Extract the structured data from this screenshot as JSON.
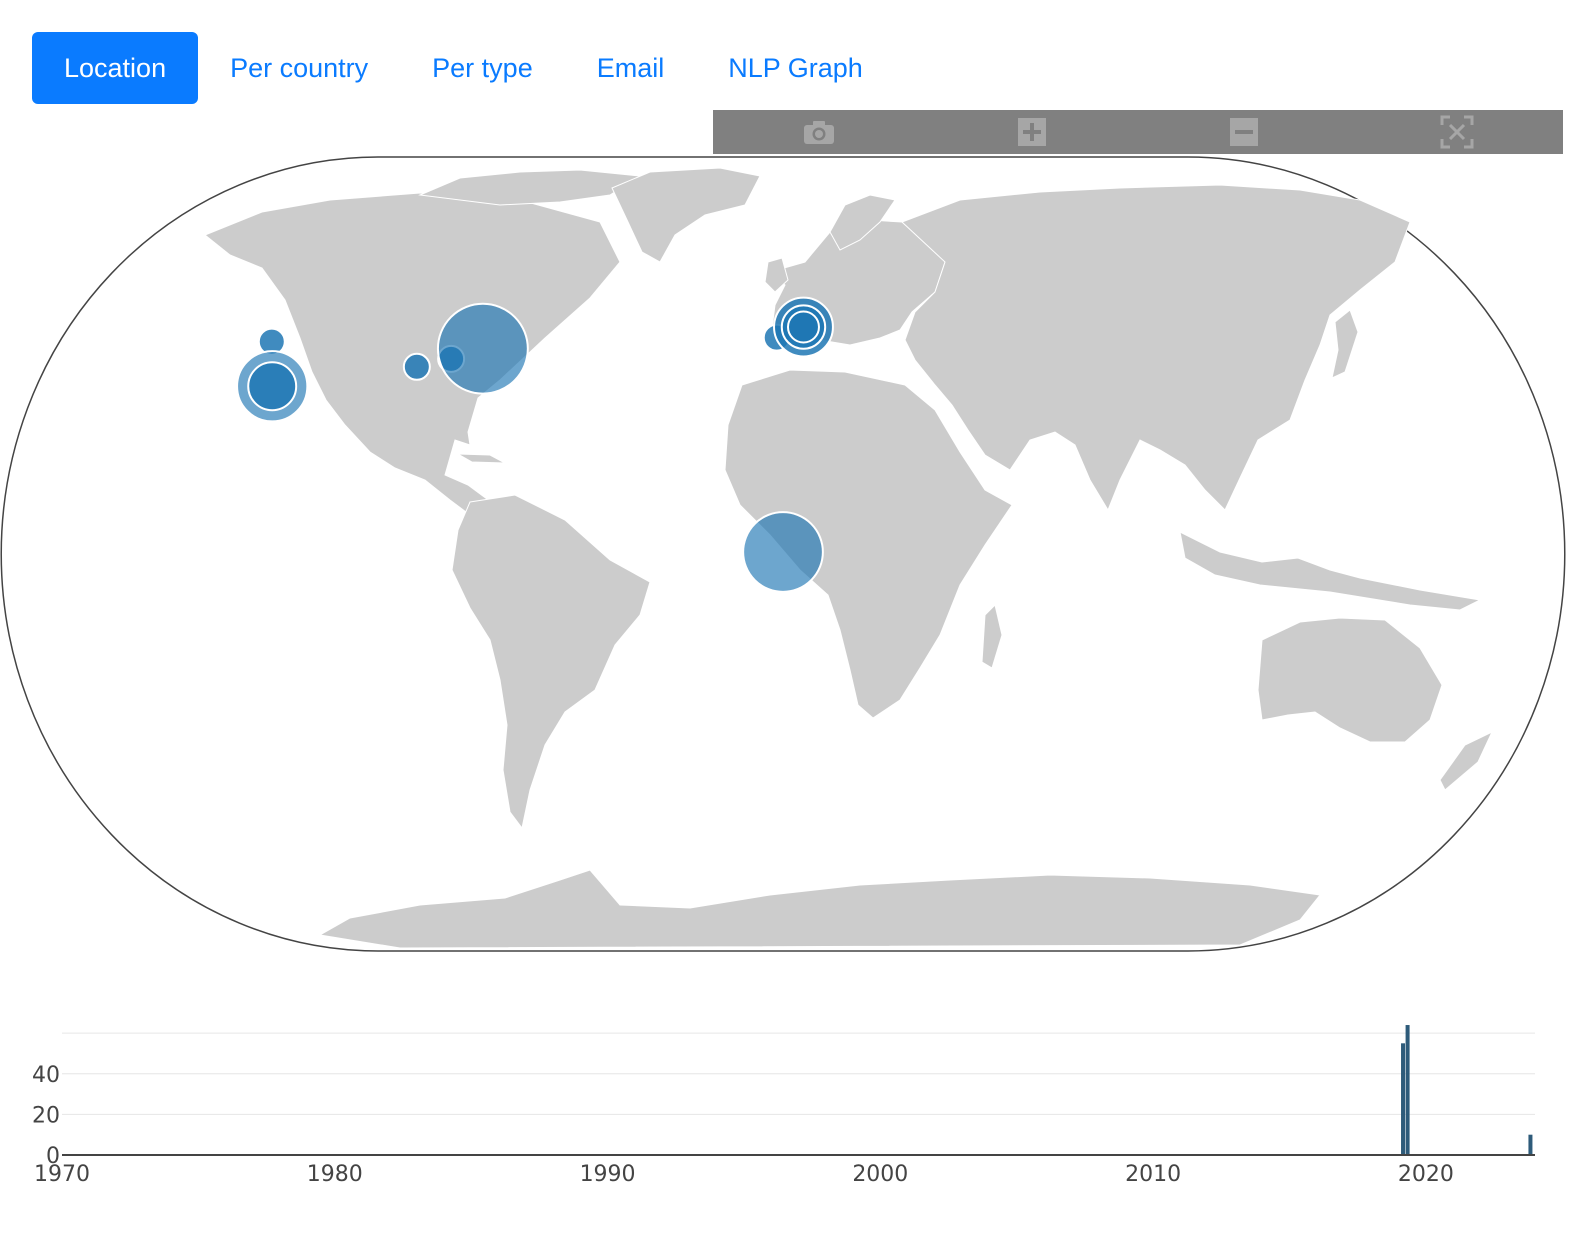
{
  "tabs": [
    {
      "label": "Location",
      "active": true
    },
    {
      "label": "Per country",
      "active": false
    },
    {
      "label": "Per type",
      "active": false
    },
    {
      "label": "Email",
      "active": false
    },
    {
      "label": "NLP Graph",
      "active": false
    }
  ],
  "modebar": {
    "buttons": [
      "camera-icon",
      "zoom-in-icon",
      "zoom-out-icon",
      "reset-view-icon"
    ],
    "background": "#808080"
  },
  "map": {
    "projection": "natural-earth",
    "land_color": "#cccccc",
    "marker_color": "#1f77b4",
    "markers": [
      {
        "lon": -122.3,
        "lat": 47.6,
        "count": 1
      },
      {
        "lon": -122.2,
        "lat": 37.5,
        "count": 22
      },
      {
        "lon": -122.2,
        "lat": 37.5,
        "count": 8
      },
      {
        "lon": -87.6,
        "lat": 41.9,
        "count": 1
      },
      {
        "lon": -79.4,
        "lat": 43.7,
        "count": 1
      },
      {
        "lon": -71.8,
        "lat": 46.0,
        "count": 40
      },
      {
        "lon": 0,
        "lat": 0,
        "count": 30
      },
      {
        "lon": -1.5,
        "lat": 48.5,
        "count": 1
      },
      {
        "lon": 4.9,
        "lat": 50.9,
        "count": 14
      },
      {
        "lon": 4.9,
        "lat": 50.9,
        "count": 6
      },
      {
        "lon": 4.9,
        "lat": 50.9,
        "count": 2
      }
    ]
  },
  "chart_data": {
    "type": "bar",
    "x_range": [
      "1970",
      "2024"
    ],
    "ylim": [
      0,
      65
    ],
    "yticks": [
      0,
      20,
      40
    ],
    "xticks": [
      "1970",
      "1980",
      "1990",
      "2000",
      "2010",
      "2020"
    ],
    "bar_color": "#2e5b7a",
    "bars": [
      {
        "x": "2019-03",
        "y": 55
      },
      {
        "x": "2019-05",
        "y": 64
      },
      {
        "x": "2023-11",
        "y": 10
      }
    ]
  }
}
